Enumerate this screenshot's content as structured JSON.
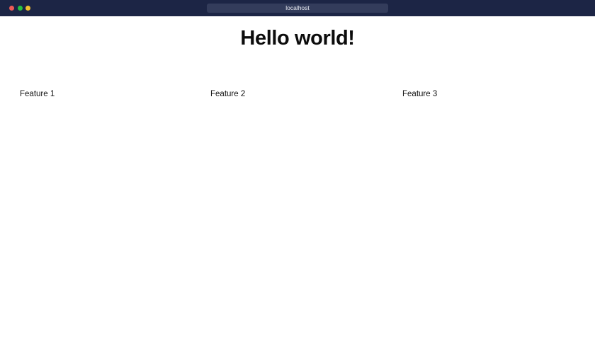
{
  "browser": {
    "url": "localhost",
    "window_controls": [
      "close",
      "minimize",
      "maximize"
    ],
    "colors": {
      "titlebar": "#1c2545",
      "urlbar": "#333c5b",
      "close": "#ee5b57",
      "minimize": "#27c23f",
      "maximize": "#f3bf2f"
    }
  },
  "page": {
    "heading": "Hello world!",
    "features": [
      "Feature 1",
      "Feature 2",
      "Feature 3"
    ]
  }
}
